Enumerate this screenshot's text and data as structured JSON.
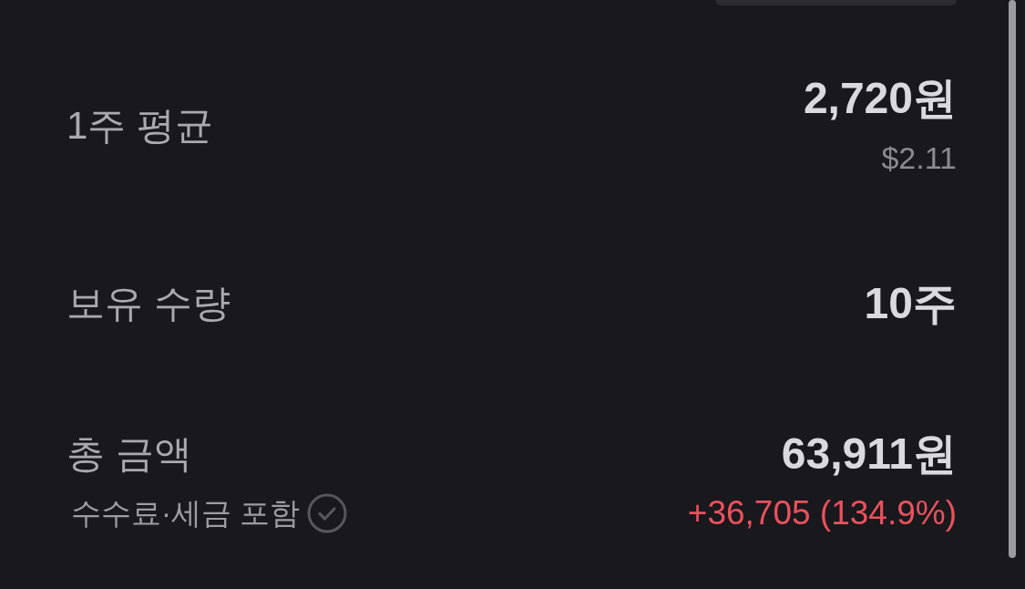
{
  "rows": [
    {
      "label": "1주 평균",
      "value": "2,720원",
      "subvalue": "$2.11"
    },
    {
      "label": "보유 수량",
      "value": "10주"
    },
    {
      "label": "총 금액",
      "note": "수수료·세금 포함",
      "value": "63,911원",
      "change": "+36,705 (134.9%)"
    }
  ]
}
